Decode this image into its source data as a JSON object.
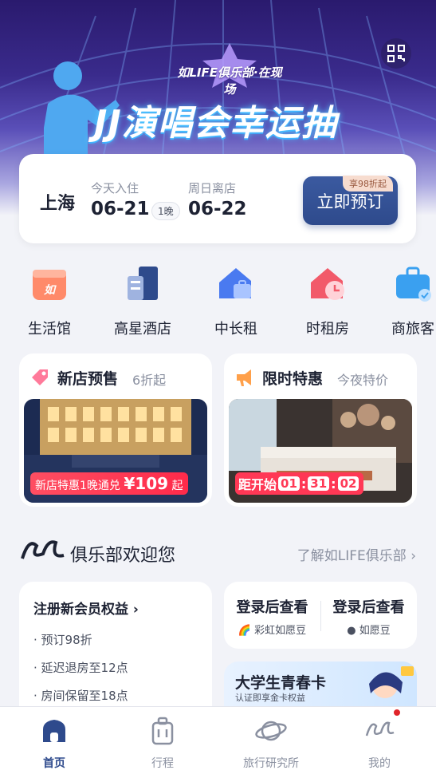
{
  "banner": {
    "logo_text": "如LIFE俱乐部·在现场",
    "title": "JJ演唱会幸运抽"
  },
  "booking": {
    "city": "上海",
    "checkin_label": "今天入住",
    "checkin_date": "06-21",
    "nights": "1晚",
    "checkout_label": "周日离店",
    "checkout_date": "06-22",
    "button_label": "立即预订",
    "badge": "享98折起"
  },
  "categories": [
    {
      "label": "生活馆",
      "icon": "life-hall-icon"
    },
    {
      "label": "高星酒店",
      "icon": "hotel-building-icon"
    },
    {
      "label": "中长租",
      "icon": "house-bag-icon"
    },
    {
      "label": "时租房",
      "icon": "house-clock-icon"
    },
    {
      "label": "商旅客",
      "icon": "briefcase-icon"
    }
  ],
  "promos": {
    "new_store": {
      "title": "新店预售",
      "subtitle": "6折起",
      "tag": "新店特惠1晚通兑",
      "price": "¥109",
      "price_suffix": "起"
    },
    "flash": {
      "title": "限时特惠",
      "subtitle": "今夜特价",
      "countdown_label": "距开始",
      "hh": "01",
      "mm": "31",
      "ss": "02"
    }
  },
  "club": {
    "title": "俱乐部欢迎您",
    "link": "了解如LIFE俱乐部",
    "member_title": "注册新会员权益",
    "benefits": [
      "· 预订98折",
      "· 延迟退房至12点",
      "· 房间保留至18点"
    ],
    "login1": "登录后查看",
    "login1_sub": "彩虹如愿豆",
    "login2": "登录后查看",
    "login2_sub": "如愿豆",
    "student_title": "大学生青春卡",
    "student_sub": "认证即享金卡权益"
  },
  "tabbar": [
    {
      "label": "首页",
      "icon": "home-icon",
      "active": true
    },
    {
      "label": "行程",
      "icon": "luggage-icon",
      "active": false
    },
    {
      "label": "旅行研究所",
      "icon": "planet-icon",
      "active": false
    },
    {
      "label": "我的",
      "icon": "profile-logo-icon",
      "active": false
    }
  ],
  "colors": {
    "primary": "#2e4a8c",
    "accent_red": "#ff3855",
    "bg": "#f2f3f8"
  }
}
